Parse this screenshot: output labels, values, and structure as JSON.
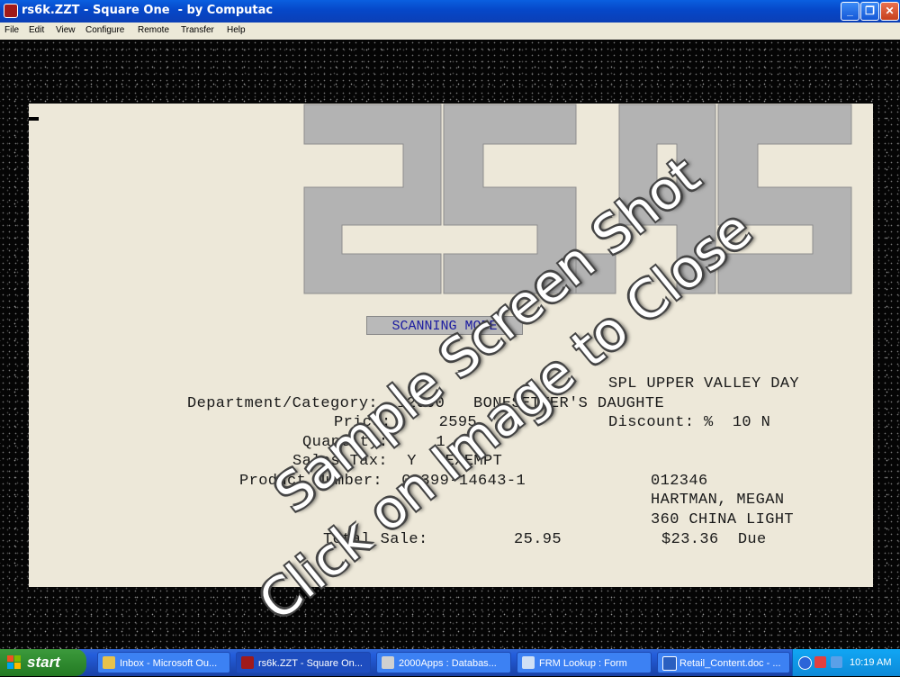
{
  "window": {
    "title": "rs6k.ZZT - Square One  - by Computac",
    "minimize_glyph": "_",
    "maximize_glyph": "❐",
    "close_glyph": "✕"
  },
  "menu": [
    "File",
    "Edit",
    "View",
    "Configure",
    "Remote",
    "Transfer",
    "Help"
  ],
  "terminal": {
    "big_amount": "25.95",
    "mode": "SCANNING MODE",
    "store_line": "SPL UPPER VALLEY DAY",
    "dept_line": "Department/Category:  12000   BONESETTER'S DAUGHTE",
    "price_line": "Price:     2595",
    "discount_line": "Discount: %  10 N",
    "quantity_line": "Quantity:     1",
    "sales_tax_line": "Sales Tax:  Y   EXEMPT",
    "product_line": "Product Number:  0-399-14643-1",
    "customer_id": "012346",
    "customer_name": "HARTMAN, MEGAN",
    "customer_addr": "360 CHINA LIGHT",
    "total_label": "Total Sale:",
    "total_value": "25.95",
    "due_line": "$23.36  Due"
  },
  "watermark": {
    "line1": "Sample Screen Shot",
    "line2": "Click on Image to Close"
  },
  "taskbar": {
    "start_label": "start",
    "tasks": [
      "Inbox - Microsoft Ou...",
      "rs6k.ZZT - Square On...",
      "2000Apps : Databas...",
      "FRM Lookup : Form",
      "Retail_Content.doc - ..."
    ],
    "clock": "10:19 AM"
  },
  "colors": {
    "screen_bg": "#ede8d9",
    "digit_fill": "#b3b3b3",
    "mode_text": "#1a1aa0"
  }
}
